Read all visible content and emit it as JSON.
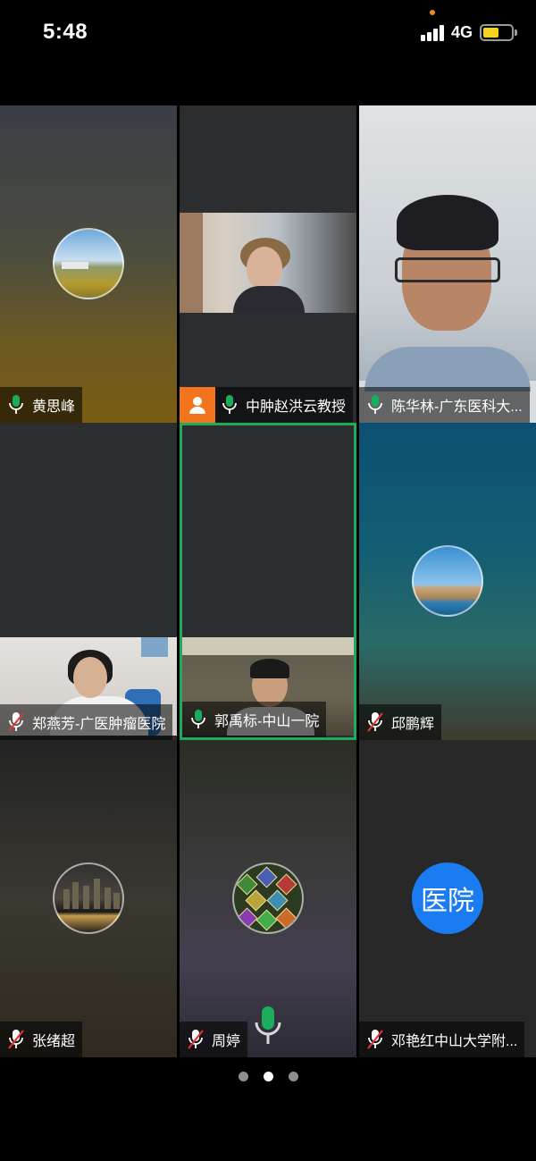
{
  "status_bar": {
    "time": "5:48",
    "network": "4G",
    "battery_level": 0.55,
    "battery_color": "#f5d31c"
  },
  "participants": [
    {
      "name": "黄思峰",
      "mic": "on",
      "view": "avatar",
      "avatar": "landscape-field"
    },
    {
      "name": "中肿赵洪云教授",
      "mic": "on",
      "view": "video",
      "host": true
    },
    {
      "name": "陈华林-广东医科大...",
      "mic": "on",
      "view": "video"
    },
    {
      "name": "郑燕芳-广医肿瘤医院",
      "mic": "off",
      "view": "video"
    },
    {
      "name": "郭禹标-中山一院",
      "mic": "on",
      "view": "video",
      "active_speaker": true
    },
    {
      "name": "邱鹏辉",
      "mic": "off",
      "view": "avatar",
      "avatar": "coastal-town"
    },
    {
      "name": "张绪超",
      "mic": "off",
      "view": "avatar",
      "avatar": "city-night"
    },
    {
      "name": "周婷",
      "mic": "off",
      "view": "avatar",
      "avatar": "gem-game"
    },
    {
      "name": "邓艳红中山大学附...",
      "mic": "off",
      "view": "avatar",
      "avatar_text": "医院"
    }
  ],
  "colors": {
    "mic_on": "#1aad5b",
    "mic_muted_slash": "#e0333a",
    "active_border": "#1aad5b",
    "host_badge": "#f2741d",
    "hospital_avatar": "#1a7cf0"
  },
  "pager": {
    "pages": 3,
    "current": 2
  }
}
